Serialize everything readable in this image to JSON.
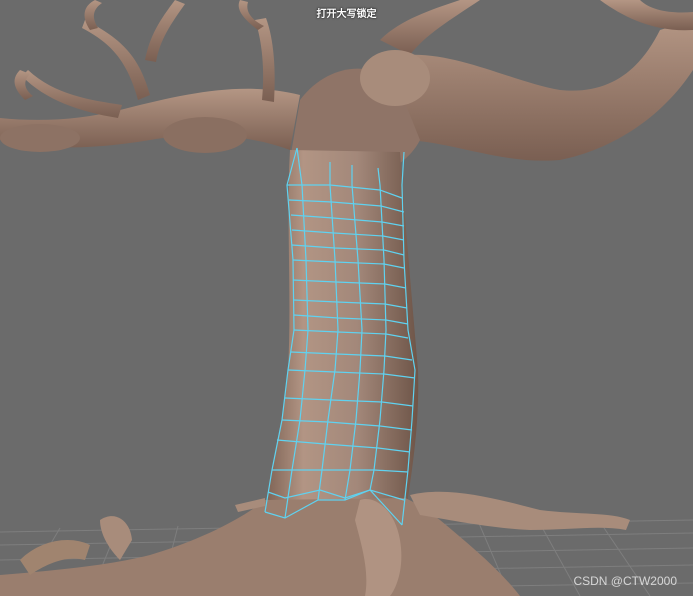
{
  "viewport": {
    "status_message": "打开大写锁定",
    "watermark": "CSDN @CTW2000",
    "colors": {
      "background": "#6b6b6b",
      "bark": "#9e8270",
      "bark_shadow": "#5e4a40",
      "wireframe": "#5fd2f0",
      "grid": "#7a7a7a"
    }
  }
}
